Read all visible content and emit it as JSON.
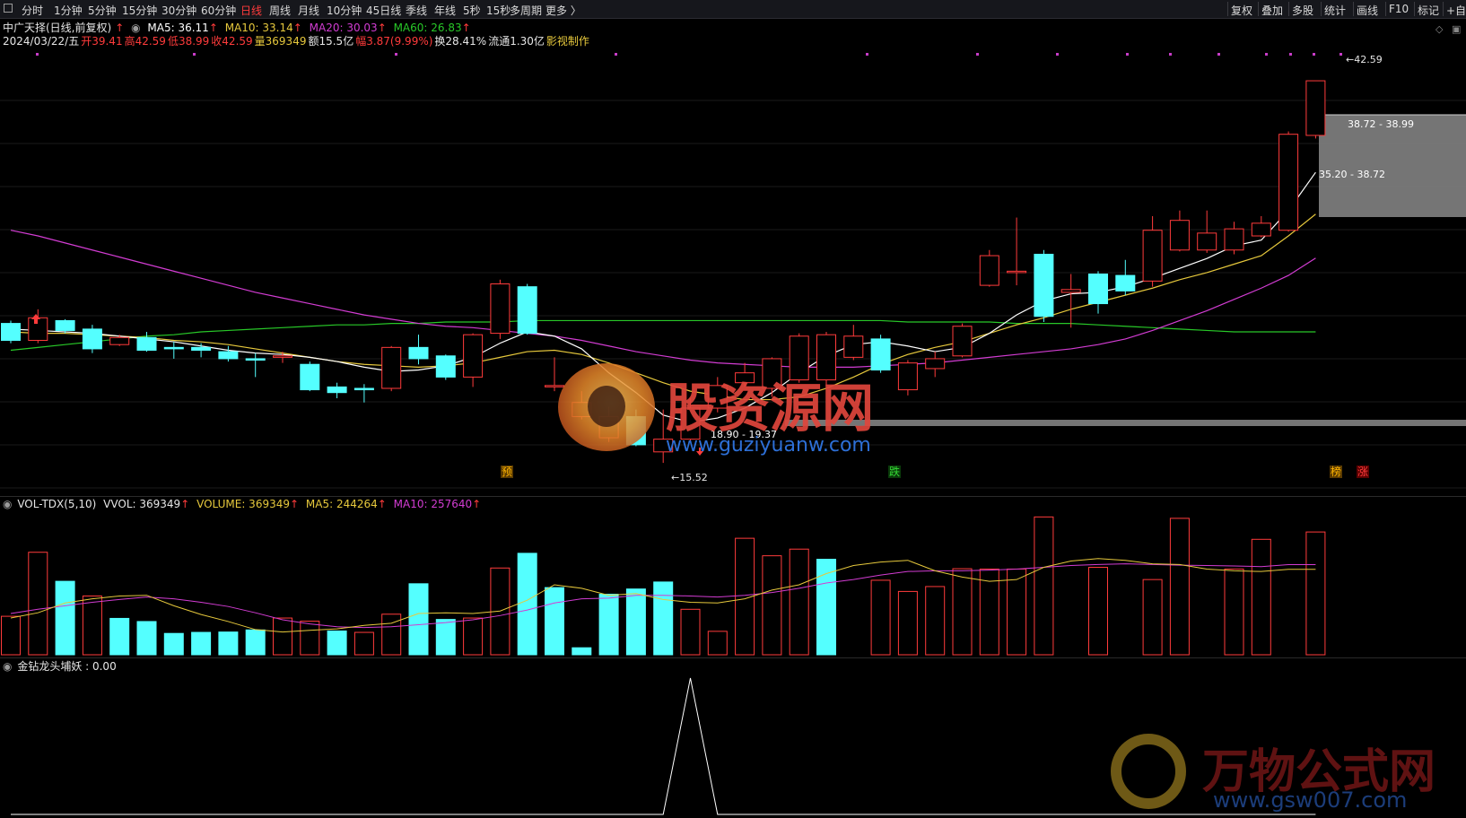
{
  "toolbar": {
    "periods": [
      "分时",
      "1分钟",
      "5分钟",
      "15分钟",
      "30分钟",
      "60分钟",
      "日线",
      "周线",
      "月线",
      "10分钟",
      "45日线",
      "季线",
      "年线",
      "5秒",
      "15秒",
      "多周期",
      "更多 〉"
    ],
    "active_period": "日线",
    "right_buttons": [
      "复权",
      "叠加",
      "多股",
      "统计",
      "画线",
      "F10",
      "标记",
      "+自"
    ]
  },
  "stock": {
    "title": "中广天择(日线,前复权)",
    "ma5": "MA5: 36.11",
    "ma10": "MA10: 33.14",
    "ma20": "MA20: 30.03",
    "ma60": "MA60: 26.83",
    "arrow": "↑"
  },
  "quote": {
    "date": "2024/03/22/五",
    "open": "开39.41",
    "high": "高42.59",
    "low": "低38.99",
    "close": "收42.59",
    "volume": "量369349",
    "amount": "额15.5亿",
    "range": "幅3.87(9.99%)",
    "turnover": "换28.41%",
    "float": "流通1.30亿",
    "maker": "影视制作"
  },
  "price_labels": {
    "high": "42.59",
    "gap_upper": "38.72 - 38.99",
    "gap_middle": "35.20 - 38.72",
    "gap_lower": "18.90 - 19.37",
    "low": "←15.52"
  },
  "markers": {
    "yu": "预",
    "die": "跌",
    "bang": "榜",
    "zhang": "涨"
  },
  "volume_panel": {
    "name": "VOL-TDX(5,10)",
    "vvol": "VVOL: 369349",
    "volume": "VOLUME: 369349",
    "ma5": "MA5: 244264",
    "ma10": "MA10: 257640"
  },
  "indicator_panel": {
    "name": "金钻龙头埔妖 : 0.00"
  },
  "watermarks": {
    "brand1": "股资源网",
    "url1": "www.guziyuanw.com",
    "brand2": "万物公式网",
    "url2": "www.gsw007.com"
  },
  "colors": {
    "up": "#ff3b3b",
    "down": "#54ffff",
    "ma5": "#ffffff",
    "ma10": "#e6c83c",
    "ma20": "#d23cd2",
    "ma60": "#28c828"
  },
  "chart_data": {
    "type": "candlestick",
    "price_range": [
      14.0,
      44.5
    ],
    "candles": [
      {
        "o": 25.4,
        "c": 24.2,
        "h": 25.6,
        "l": 24.0
      },
      {
        "o": 24.2,
        "c": 25.8,
        "h": 26.4,
        "l": 24.0
      },
      {
        "o": 25.6,
        "c": 24.9,
        "h": 25.7,
        "l": 24.7
      },
      {
        "o": 25.0,
        "c": 23.6,
        "h": 25.3,
        "l": 23.3
      },
      {
        "o": 23.9,
        "c": 24.4,
        "h": 24.6,
        "l": 23.8
      },
      {
        "o": 24.4,
        "c": 23.5,
        "h": 24.8,
        "l": 23.4
      },
      {
        "o": 23.7,
        "c": 23.6,
        "h": 24.1,
        "l": 22.9
      },
      {
        "o": 23.7,
        "c": 23.5,
        "h": 24.0,
        "l": 23.0
      },
      {
        "o": 23.4,
        "c": 22.9,
        "h": 23.8,
        "l": 22.7
      },
      {
        "o": 22.9,
        "c": 22.8,
        "h": 23.3,
        "l": 21.6
      },
      {
        "o": 23.0,
        "c": 23.1,
        "h": 23.4,
        "l": 22.6
      },
      {
        "o": 22.5,
        "c": 20.7,
        "h": 22.7,
        "l": 20.6
      },
      {
        "o": 20.9,
        "c": 20.5,
        "h": 21.2,
        "l": 20.1
      },
      {
        "o": 20.8,
        "c": 20.7,
        "h": 21.1,
        "l": 19.8
      },
      {
        "o": 20.8,
        "c": 23.7,
        "h": 23.8,
        "l": 20.6
      },
      {
        "o": 23.7,
        "c": 22.9,
        "h": 24.6,
        "l": 22.5
      },
      {
        "o": 23.1,
        "c": 21.6,
        "h": 23.2,
        "l": 21.4
      },
      {
        "o": 21.6,
        "c": 24.6,
        "h": 24.7,
        "l": 20.9
      },
      {
        "o": 24.7,
        "c": 28.2,
        "h": 28.5,
        "l": 24.3
      },
      {
        "o": 28.0,
        "c": 24.7,
        "h": 28.2,
        "l": 24.6
      },
      {
        "o": 21.0,
        "c": 21.0,
        "h": 23.0,
        "l": 20.6
      },
      {
        "o": 18.8,
        "c": 19.8,
        "h": 20.6,
        "l": 18.6
      },
      {
        "o": 17.3,
        "c": 18.8,
        "h": 19.5,
        "l": 17.0
      },
      {
        "o": 18.8,
        "c": 16.8,
        "h": 19.3,
        "l": 16.7
      },
      {
        "o": 16.3,
        "c": 17.2,
        "h": 19.3,
        "l": 15.52
      },
      {
        "o": 17.2,
        "c": 19.4,
        "h": 20.1,
        "l": 17.1
      },
      {
        "o": 19.4,
        "c": 21.0,
        "h": 21.6,
        "l": 19.1
      },
      {
        "o": 21.2,
        "c": 21.9,
        "h": 22.6,
        "l": 20.9
      },
      {
        "o": 20.8,
        "c": 22.9,
        "h": 23.0,
        "l": 20.2
      },
      {
        "o": 21.4,
        "c": 24.5,
        "h": 24.7,
        "l": 21.2
      },
      {
        "o": 21.4,
        "c": 24.6,
        "h": 24.8,
        "l": 21.0
      },
      {
        "o": 23.0,
        "c": 24.5,
        "h": 25.3,
        "l": 22.8
      },
      {
        "o": 24.3,
        "c": 22.1,
        "h": 24.6,
        "l": 21.9
      },
      {
        "o": 20.7,
        "c": 22.6,
        "h": 22.8,
        "l": 20.3
      },
      {
        "o": 22.2,
        "c": 22.9,
        "h": 23.4,
        "l": 21.6
      },
      {
        "o": 23.1,
        "c": 25.2,
        "h": 25.4,
        "l": 23.0
      },
      {
        "o": 28.1,
        "c": 30.2,
        "h": 30.6,
        "l": 28.0
      },
      {
        "o": 29.0,
        "c": 29.1,
        "h": 32.9,
        "l": 28.1
      },
      {
        "o": 30.3,
        "c": 25.9,
        "h": 30.6,
        "l": 25.5
      },
      {
        "o": 27.6,
        "c": 27.8,
        "h": 28.9,
        "l": 25.1
      },
      {
        "o": 28.9,
        "c": 26.8,
        "h": 29.1,
        "l": 26.1
      },
      {
        "o": 28.8,
        "c": 27.7,
        "h": 29.9,
        "l": 27.4
      },
      {
        "o": 28.4,
        "c": 32.0,
        "h": 33.0,
        "l": 28.0
      },
      {
        "o": 30.6,
        "c": 32.7,
        "h": 33.4,
        "l": 30.5
      },
      {
        "o": 30.6,
        "c": 31.8,
        "h": 33.4,
        "l": 30.4
      },
      {
        "o": 30.6,
        "c": 32.1,
        "h": 32.6,
        "l": 30.3
      },
      {
        "o": 31.6,
        "c": 32.5,
        "h": 33.0,
        "l": 31.5
      },
      {
        "o": 32.0,
        "c": 38.8,
        "h": 39.0,
        "l": 31.9
      },
      {
        "o": 38.72,
        "c": 42.59,
        "h": 42.59,
        "l": 38.5
      }
    ],
    "ma5": [
      25.0,
      24.9,
      24.8,
      24.7,
      24.5,
      24.3,
      24.1,
      23.8,
      23.5,
      23.3,
      23.2,
      23.0,
      22.7,
      22.3,
      22.0,
      22.1,
      22.4,
      23.0,
      24.0,
      24.8,
      24.5,
      23.6,
      21.9,
      20.5,
      18.9,
      18.4,
      18.7,
      19.4,
      20.5,
      21.9,
      23.1,
      23.9,
      24.1,
      23.8,
      23.4,
      23.7,
      24.7,
      26.0,
      27.0,
      27.5,
      27.6,
      28.0,
      28.6,
      29.3,
      30.0,
      30.9,
      31.3,
      33.4,
      36.1
    ],
    "ma10": [
      24.8,
      24.7,
      24.7,
      24.6,
      24.5,
      24.4,
      24.2,
      24.1,
      23.9,
      23.6,
      23.3,
      23.0,
      22.7,
      22.5,
      22.4,
      22.3,
      22.4,
      22.6,
      23.0,
      23.4,
      23.5,
      23.2,
      22.6,
      21.9,
      21.2,
      20.6,
      20.3,
      20.0,
      20.0,
      20.2,
      20.8,
      21.6,
      22.5,
      23.2,
      23.7,
      24.1,
      24.7,
      25.3,
      25.8,
      26.4,
      26.9,
      27.4,
      27.9,
      28.5,
      29.0,
      29.6,
      30.2,
      31.6,
      33.14
    ],
    "ma20": [
      32.0,
      31.6,
      31.1,
      30.6,
      30.1,
      29.6,
      29.1,
      28.6,
      28.1,
      27.6,
      27.2,
      26.8,
      26.4,
      26.0,
      25.7,
      25.4,
      25.2,
      25.1,
      24.9,
      24.7,
      24.5,
      24.2,
      23.8,
      23.4,
      23.1,
      22.8,
      22.6,
      22.5,
      22.4,
      22.3,
      22.3,
      22.3,
      22.4,
      22.5,
      22.6,
      22.8,
      23.0,
      23.2,
      23.4,
      23.6,
      23.9,
      24.3,
      24.9,
      25.6,
      26.3,
      27.1,
      27.9,
      28.8,
      30.03
    ],
    "ma60": [
      23.5,
      23.7,
      23.9,
      24.1,
      24.3,
      24.5,
      24.6,
      24.8,
      24.9,
      25.0,
      25.1,
      25.2,
      25.3,
      25.3,
      25.4,
      25.4,
      25.5,
      25.5,
      25.5,
      25.6,
      25.6,
      25.6,
      25.6,
      25.6,
      25.6,
      25.6,
      25.6,
      25.6,
      25.6,
      25.6,
      25.6,
      25.6,
      25.6,
      25.5,
      25.5,
      25.5,
      25.5,
      25.4,
      25.4,
      25.4,
      25.3,
      25.2,
      25.1,
      25.0,
      24.9,
      24.8,
      24.8,
      24.8,
      24.8
    ],
    "volume": {
      "range": [
        0,
        400000
      ],
      "values": [
        110000,
        293000,
        210000,
        168000,
        104000,
        95000,
        61000,
        64000,
        65000,
        71000,
        105000,
        96000,
        68000,
        64000,
        116000,
        203000,
        101000,
        105000,
        248000,
        290000,
        192000,
        20000,
        173000,
        188000,
        208000,
        130000,
        67000,
        333000,
        283000,
        302000,
        273000,
        0,
        213000,
        181000,
        195000,
        246000,
        245000,
        245000,
        394000,
        0,
        250000,
        0,
        215000,
        390000,
        0,
        245000,
        330000,
        0,
        351000,
        20000,
        0,
        352000
      ],
      "up": [
        true,
        true,
        false,
        true,
        false,
        false,
        false,
        false,
        false,
        false,
        true,
        true,
        false,
        true,
        true,
        false,
        false,
        true,
        true,
        false,
        false,
        false,
        false,
        false,
        false,
        true,
        true,
        true,
        true,
        true,
        false,
        true,
        true,
        true,
        true,
        true,
        true,
        true,
        true,
        true,
        true,
        true,
        true,
        true,
        true,
        true,
        true,
        true,
        true,
        true,
        true,
        true
      ],
      "ma5": [
        105000,
        120000,
        148000,
        160000,
        168000,
        170000,
        140000,
        115000,
        95000,
        72000,
        65000,
        70000,
        74000,
        84000,
        90000,
        118000,
        120000,
        118000,
        125000,
        156000,
        200000,
        190000,
        170000,
        175000,
        158000,
        150000,
        148000,
        160000,
        185000,
        200000,
        232000,
        255000,
        265000,
        270000,
        240000,
        222000,
        210000,
        215000,
        250000,
        268000,
        275000,
        270000,
        260000,
        258000,
        245000,
        240000,
        238000,
        244264,
        244264
      ],
      "ma10": [
        118000,
        130000,
        140000,
        150000,
        158000,
        165000,
        160000,
        150000,
        138000,
        120000,
        100000,
        88000,
        80000,
        78000,
        80000,
        86000,
        92000,
        100000,
        112000,
        128000,
        148000,
        160000,
        162000,
        170000,
        170000,
        168000,
        165000,
        170000,
        178000,
        190000,
        205000,
        215000,
        228000,
        238000,
        240000,
        240000,
        242000,
        245000,
        250000,
        255000,
        258000,
        260000,
        258000,
        256000,
        255000,
        254000,
        252000,
        257640,
        257640
      ]
    },
    "indicator": {
      "range": [
        0,
        1
      ],
      "spike_index": 25,
      "value": 0.0
    }
  }
}
